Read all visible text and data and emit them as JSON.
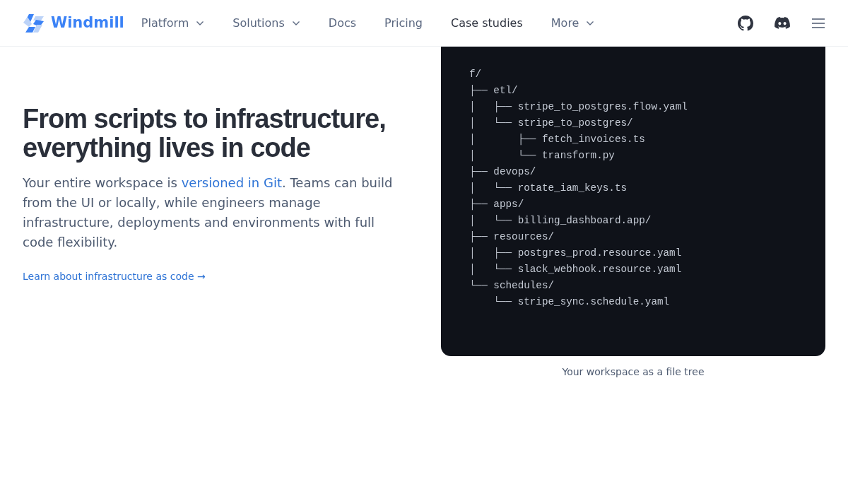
{
  "brand": {
    "name": "Windmill"
  },
  "nav": [
    {
      "label": "Platform",
      "dropdown": true,
      "selected": false
    },
    {
      "label": "Solutions",
      "dropdown": true,
      "selected": false
    },
    {
      "label": "Docs",
      "dropdown": false,
      "selected": false
    },
    {
      "label": "Pricing",
      "dropdown": false,
      "selected": false
    },
    {
      "label": "Case studies",
      "dropdown": false,
      "selected": true
    },
    {
      "label": "More",
      "dropdown": true,
      "selected": false
    }
  ],
  "hero": {
    "title": "From scripts to infrastructure, everything lives in code",
    "body": [
      {
        "text": "Your entire workspace is ",
        "kind": "text"
      },
      {
        "text": "versioned in Git",
        "kind": "link"
      },
      {
        "text": ". Teams can build from the UI or locally, while engineers manage infrastructure, deployments and environments with full code flexibility.",
        "kind": "text"
      }
    ],
    "link": "Learn about infrastructure as code →"
  },
  "file_tree": {
    "lines": [
      "f/",
      "├── etl/",
      "│   ├── stripe_to_postgres.flow.yaml",
      "│   └── stripe_to_postgres/",
      "│       ├── fetch_invoices.ts",
      "│       └── transform.py",
      "├── devops/",
      "│   └── rotate_iam_keys.ts",
      "├── apps/",
      "│   └── billing_dashboard.app/",
      "├── resources/",
      "│   ├── postgres_prod.resource.yaml",
      "│   └── slack_webhook.resource.yaml",
      "└── schedules/",
      "    └── stripe_sync.schedule.yaml"
    ],
    "caption": "Your workspace as a file tree"
  }
}
